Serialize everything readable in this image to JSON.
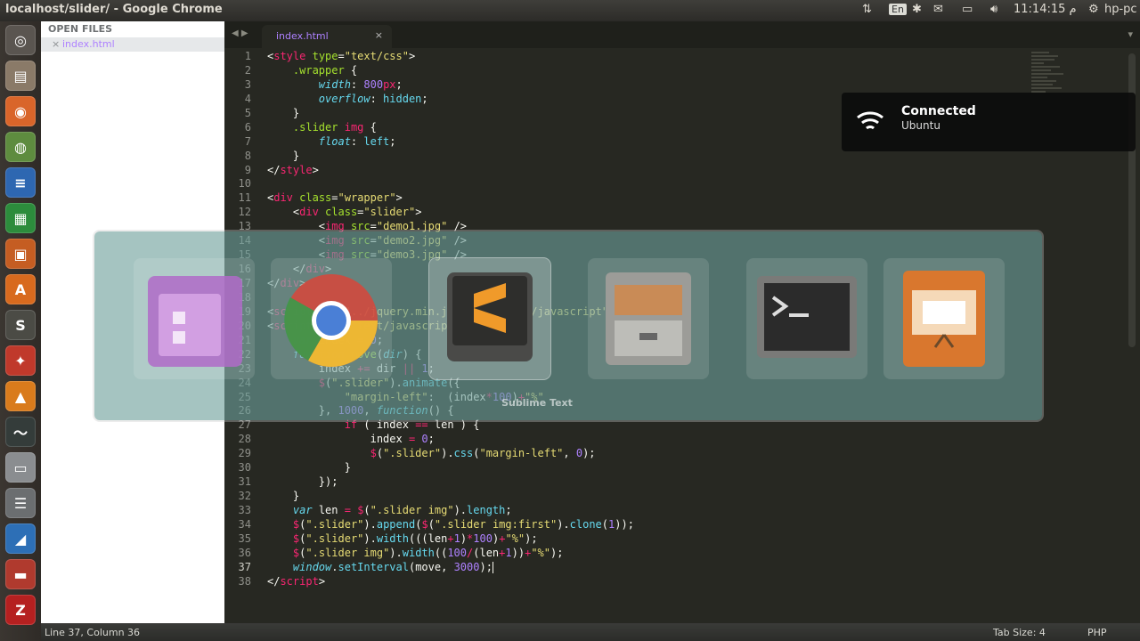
{
  "window": {
    "title": "localhost/slider/ - Google Chrome"
  },
  "indicators": {
    "keyboard": "En",
    "clock": "11:14:15 م",
    "user": "hp-pc"
  },
  "sidebar": {
    "header": "OPEN FILES",
    "file": "index.html",
    "close": "×"
  },
  "tab": {
    "name": "index.html",
    "close": "×",
    "nav": "◀ ▶",
    "menu": "▾"
  },
  "status": {
    "position": "Line 37, Column 36",
    "tab_size": "Tab Size: 4",
    "syntax": "PHP"
  },
  "notification": {
    "title": "Connected",
    "body": "Ubuntu"
  },
  "switcher": {
    "label": "Sublime Text"
  },
  "code_lines": [
    "1",
    "2",
    "3",
    "4",
    "5",
    "6",
    "7",
    "8",
    "9",
    "10",
    "11",
    "12",
    "13",
    "14",
    "15",
    "16",
    "17",
    "18",
    "19",
    "20",
    "21",
    "22",
    "23",
    "24",
    "25",
    "26",
    "27",
    "28",
    "29",
    "30",
    "31",
    "32",
    "33",
    "34",
    "35",
    "36",
    "37",
    "38"
  ],
  "colors": {
    "editor_bg": "#272822",
    "tag": "#f92672",
    "attr": "#a6e22e",
    "string": "#e6db74",
    "number": "#ae81ff",
    "keyword": "#66d9ef"
  },
  "icons": [
    "ubuntu-icon",
    "files-icon",
    "firefox-icon",
    "chrome-icon",
    "writer-icon",
    "calc-icon",
    "impress-icon",
    "software-center-icon",
    "sublime-icon",
    "settings-icon",
    "vlc-icon",
    "monitor-icon",
    "drive-icon",
    "stack-icon",
    "git-icon",
    "disk-icon",
    "filezilla-icon"
  ]
}
